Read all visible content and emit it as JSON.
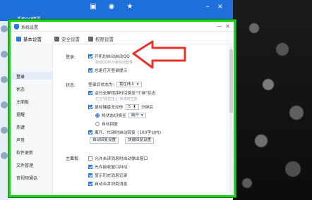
{
  "qq": {
    "name": "手机QQ精灵"
  },
  "window": {
    "title": "系统设置",
    "minimize_glyph": "—",
    "close_glyph": "✕"
  },
  "tabs": [
    {
      "label": "基本设置",
      "icon": "gear-icon",
      "active": true
    },
    {
      "label": "安全设置",
      "icon": "shield-icon",
      "active": false
    },
    {
      "label": "权限设置",
      "icon": "lock-icon",
      "active": false
    }
  ],
  "nav": [
    {
      "label": "登录"
    },
    {
      "label": "状态"
    },
    {
      "label": "主面板"
    },
    {
      "label": "提醒"
    },
    {
      "label": "热键"
    },
    {
      "label": "声音"
    },
    {
      "label": "软件更新"
    },
    {
      "label": "文件管理"
    },
    {
      "label": "音视频通话"
    }
  ],
  "login": {
    "section": "登录:",
    "autostart": "开机时自动启动QQ",
    "autostart_hint": "启动QQ时为我自动登录",
    "open_reminder": "总是打开登录提示"
  },
  "status": {
    "section": "状态:",
    "login_status_label": "登录后状态为:",
    "login_status_value": "我在线上",
    "fullscreen_busy": "运行全屏程序时切换至\"忙碌\"状态",
    "fullscreen_hint": "仅在\"我在线上\"状态时生效",
    "idle_label": "鼠标键盘无动作",
    "idle_minutes": "5",
    "idle_unit": "分钟后",
    "switch_label": "将状态切换至",
    "switch_value": "离开",
    "auto_reply": "自动回复",
    "leave_reply": "离开、忙碌时自动回复",
    "leave_reply_limit": "(100字以内)",
    "btn_auto_reply": "自动回复设置",
    "btn_quick_reply": "快捷回复设置"
  },
  "panel": {
    "section": "主面板:",
    "opt1": "允许未读消息时自动弹出窗口",
    "opt2": "允许接收窗口抖动",
    "opt3": "显示历史消息记录",
    "opt4": "自动合并同类消息"
  },
  "colors": {
    "highlight": "#1ed31e",
    "accent": "#2c7be5",
    "arrow": "#e8332a"
  }
}
